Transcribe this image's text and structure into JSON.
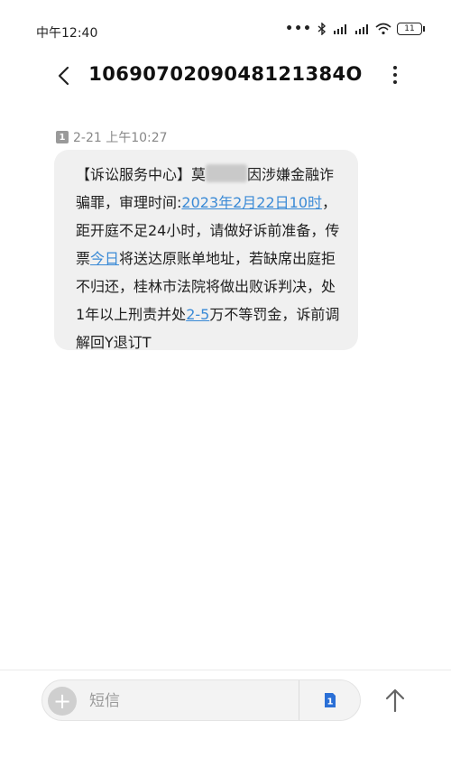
{
  "status_bar": {
    "time": "中午12:40",
    "battery": "11"
  },
  "header": {
    "title": "1069070209048121384O"
  },
  "message": {
    "sim_slot": "1",
    "timestamp": "2-21 上午10:27",
    "parts": {
      "p1": "【诉讼服务中心】莫",
      "p2": "因涉嫌金融诈骗罪，审理时间:",
      "link_date": "2023年2月22日10时",
      "p3": "，距开庭不足24小时，请做好诉前准备，传票",
      "link_today": "今日",
      "p4": "将送达原账单地址，若缺席出庭拒不归还，桂林市法院将做出败诉判决，处1年以上刑责并处",
      "link_range": "2-5",
      "p5": "万不等罚金，诉前调解回Y退订T"
    }
  },
  "compose": {
    "placeholder": "短信",
    "sim_slot": "1"
  }
}
